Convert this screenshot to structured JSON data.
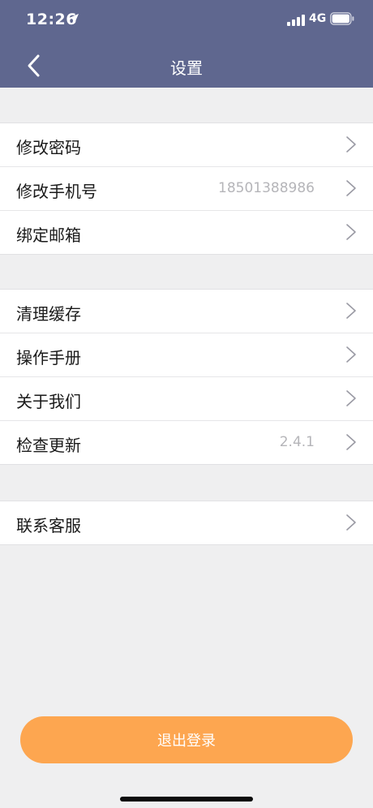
{
  "status_bar": {
    "time": "12:26",
    "network": "4G",
    "icons": [
      "location-arrow-icon",
      "signal-icon",
      "battery-icon"
    ]
  },
  "header": {
    "title": "设置",
    "back_icon": "chevron-left-icon",
    "background": "#5f678f"
  },
  "groups": [
    {
      "items": [
        {
          "label": "修改密码",
          "value": ""
        },
        {
          "label": "修改手机号",
          "value": "18501388986"
        },
        {
          "label": "绑定邮箱",
          "value": ""
        }
      ]
    },
    {
      "items": [
        {
          "label": "清理缓存",
          "value": ""
        },
        {
          "label": "操作手册",
          "value": ""
        },
        {
          "label": "关于我们",
          "value": ""
        },
        {
          "label": "检查更新",
          "value": "2.4.1"
        }
      ]
    },
    {
      "items": [
        {
          "label": "联系客服",
          "value": ""
        }
      ]
    }
  ],
  "logout_button": {
    "label": "退出登录",
    "color": "#fda650"
  }
}
